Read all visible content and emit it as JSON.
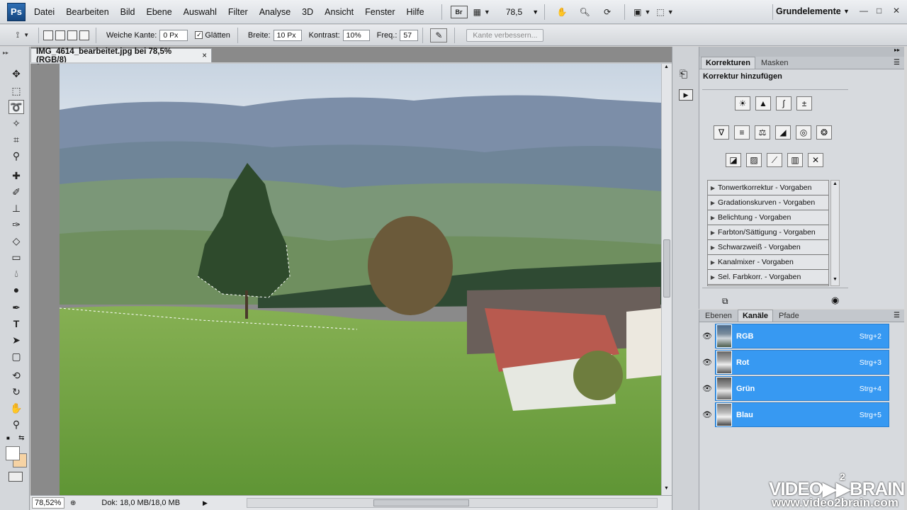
{
  "app": {
    "logo": "Ps"
  },
  "menubar": {
    "items": [
      "Datei",
      "Bearbeiten",
      "Bild",
      "Ebene",
      "Auswahl",
      "Filter",
      "Analyse",
      "3D",
      "Ansicht",
      "Fenster",
      "Hilfe"
    ],
    "bridge_label": "Br",
    "zoom": "78,5",
    "workspace": "Grundelemente"
  },
  "options": {
    "feather_label": "Weiche Kante:",
    "feather_value": "0 Px",
    "antialias_label": "Glätten",
    "width_label": "Breite:",
    "width_value": "10 Px",
    "contrast_label": "Kontrast:",
    "contrast_value": "10%",
    "freq_label": "Freq.:",
    "freq_value": "57",
    "refine_edge_label": "Kante verbessern..."
  },
  "document": {
    "tab_title": "IMG_4614_bearbeitet.jpg bei 78,5% (RGB/8)",
    "close": "×"
  },
  "status": {
    "zoom": "78,52%",
    "doc_size": "Dok: 18,0 MB/18,0 MB"
  },
  "adjustments": {
    "tabs": [
      "Korrekturen",
      "Masken"
    ],
    "heading": "Korrektur hinzufügen",
    "presets": [
      "Tonwertkorrektur - Vorgaben",
      "Gradationskurven - Vorgaben",
      "Belichtung - Vorgaben",
      "Farbton/Sättigung - Vorgaben",
      "Schwarzweiß - Vorgaben",
      "Kanalmixer - Vorgaben",
      "Sel. Farbkorr. - Vorgaben"
    ]
  },
  "layers_panel": {
    "tabs": [
      "Ebenen",
      "Kanäle",
      "Pfade"
    ],
    "channels": [
      {
        "name": "RGB",
        "shortcut": "Strg+2"
      },
      {
        "name": "Rot",
        "shortcut": "Strg+3"
      },
      {
        "name": "Grün",
        "shortcut": "Strg+4"
      },
      {
        "name": "Blau",
        "shortcut": "Strg+5"
      }
    ]
  },
  "watermark": {
    "brand": "VIDEO▶▶BRAIN",
    "superscript": "2",
    "url": "www.video2brain.com"
  },
  "colors": {
    "accent": "#3799f2",
    "foreground": "#ffffff",
    "background": "#f6d3a4"
  }
}
